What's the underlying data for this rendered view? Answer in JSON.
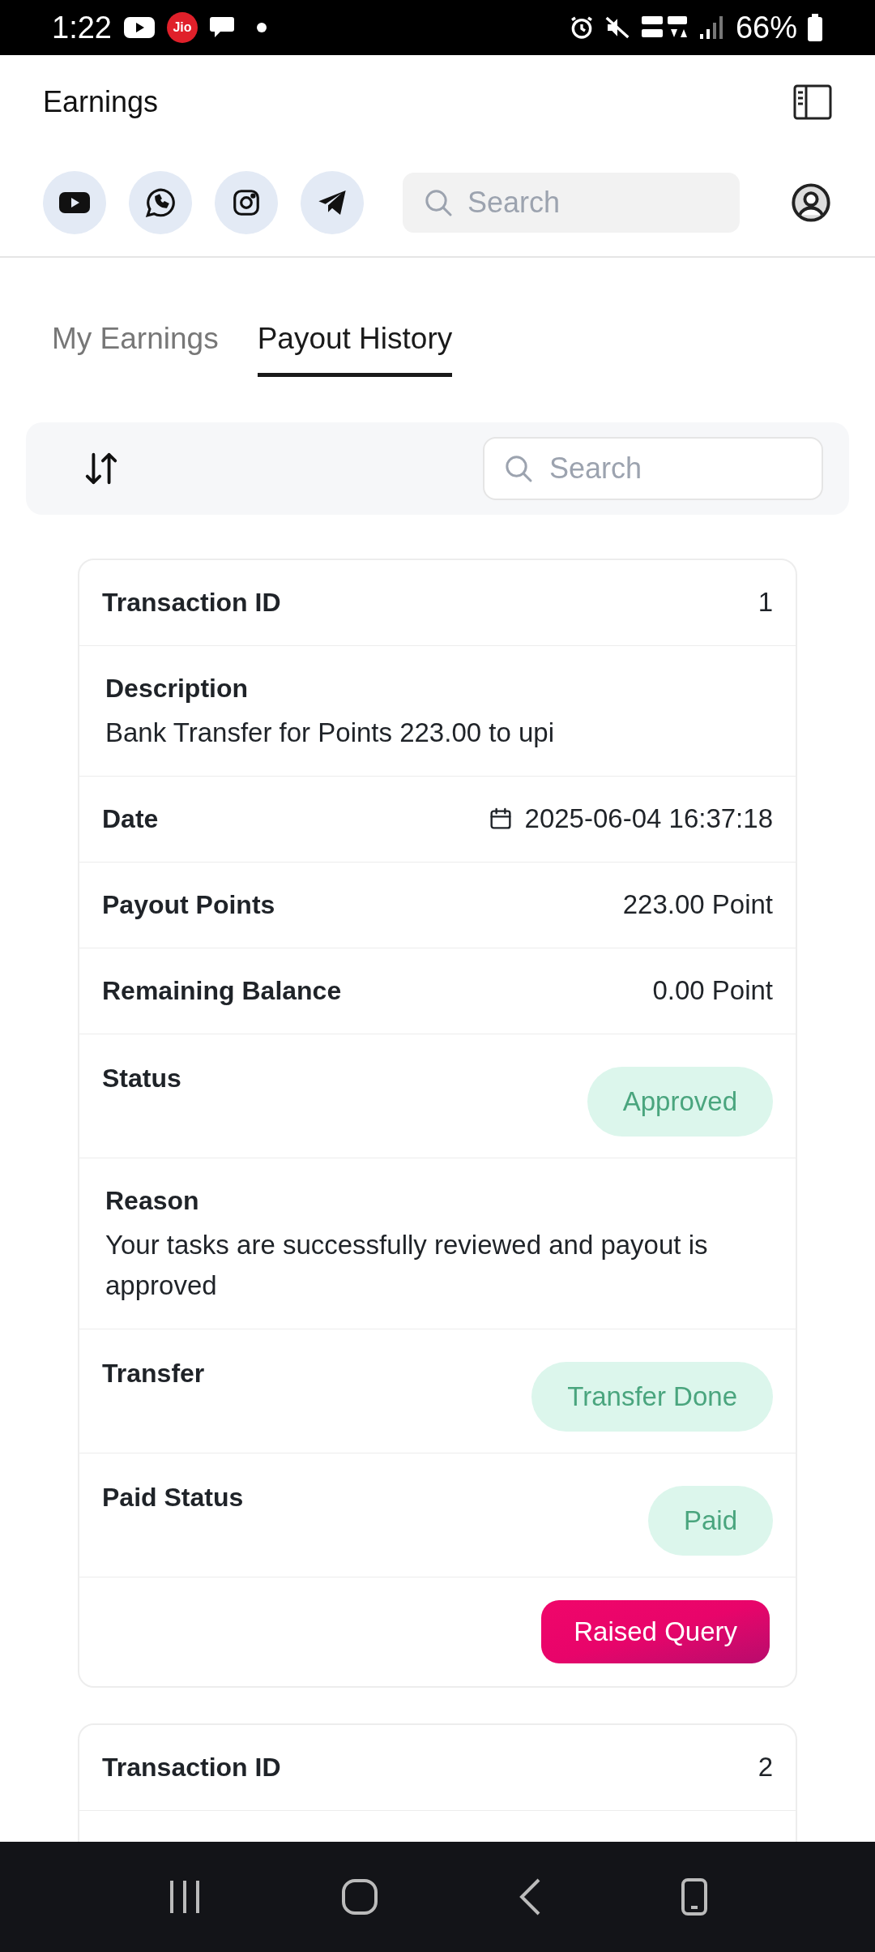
{
  "status_bar": {
    "time": "1:22",
    "carrier_badge": "Jio",
    "battery": "66%"
  },
  "header": {
    "title": "Earnings",
    "search": {
      "placeholder": "Search"
    }
  },
  "tabs": [
    {
      "label": "My Earnings",
      "selected": false
    },
    {
      "label": "Payout History",
      "selected": true
    }
  ],
  "toolbar": {
    "search": {
      "placeholder": "Search"
    }
  },
  "cards": [
    {
      "rows": [
        {
          "kind": "pair",
          "label": "Transaction ID",
          "value": "1"
        },
        {
          "kind": "block",
          "label": "Description",
          "value": "Bank Transfer for Points 223.00 to upi"
        },
        {
          "kind": "date",
          "label": "Date",
          "value": "2025-06-04 16:37:18"
        },
        {
          "kind": "pair",
          "label": "Payout Points",
          "value": "223.00 Point"
        },
        {
          "kind": "pair",
          "label": "Remaining Balance",
          "value": "0.00 Point"
        },
        {
          "kind": "badge",
          "label": "Status",
          "value": "Approved"
        },
        {
          "kind": "block",
          "label": "Reason",
          "value": "Your tasks are successfully reviewed and payout is approved"
        },
        {
          "kind": "badge",
          "label": "Transfer",
          "value": "Transfer Done"
        },
        {
          "kind": "badge",
          "label": "Paid Status",
          "value": "Paid"
        },
        {
          "kind": "action",
          "value": "Raised Query"
        }
      ]
    },
    {
      "rows": [
        {
          "kind": "pair",
          "label": "Transaction ID",
          "value": "2"
        }
      ]
    }
  ]
}
